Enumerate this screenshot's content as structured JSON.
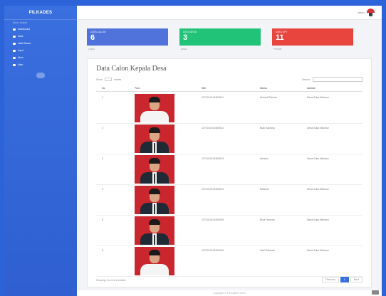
{
  "brand": "PILKADES",
  "sidebar": {
    "section_label": "Menu Utama",
    "items": [
      {
        "label": "Dashboard"
      },
      {
        "label": "Data"
      },
      {
        "label": "Hasil Suara"
      },
      {
        "label": "Input"
      },
      {
        "label": "Akun"
      },
      {
        "label": "User"
      }
    ]
  },
  "topbar": {
    "user_name": "admin"
  },
  "cards": [
    {
      "title": "DATA CALON",
      "value": "6",
      "sub": "Calon",
      "color": "#4f73db"
    },
    {
      "title": "DATA DESA",
      "value": "3",
      "sub": "Desa",
      "color": "#20c378"
    },
    {
      "title": "DATA DPT",
      "value": "11",
      "sub": "Pemilih",
      "color": "#e8453f"
    }
  ],
  "panel": {
    "title": "Data Calon Kepala Desa",
    "show_label": "Show",
    "show_value": "10",
    "entries_label": "entries",
    "search_label": "Search:",
    "columns": [
      "No",
      "Foto",
      "NIK",
      "Nama",
      "Alamat"
    ],
    "rows": [
      {
        "no": "1",
        "nik": "1371010101900001",
        "nama": "Ahmad Ridwan",
        "alamat": "Desa Suka Makmur",
        "suit": "white"
      },
      {
        "no": "2",
        "nik": "1371010101900002",
        "nama": "Budi Santoso",
        "alamat": "Desa Suka Makmur",
        "suit": "dark"
      },
      {
        "no": "3",
        "nik": "1371010101900003",
        "nama": "Hendra",
        "alamat": "Desa Suka Makmur",
        "suit": "dark"
      },
      {
        "no": "4",
        "nik": "1371010101900004",
        "nama": "Rahmat",
        "alamat": "Desa Suka Makmur",
        "suit": "dark"
      },
      {
        "no": "5",
        "nik": "1371010101900005",
        "nama": "Rudi Hartono",
        "alamat": "Desa Suka Makmur",
        "suit": "dark"
      },
      {
        "no": "6",
        "nik": "1371010101900006",
        "nama": "Zaki Rahman",
        "alamat": "Desa Suka Makmur",
        "suit": "white"
      }
    ],
    "footer_text": "Showing 1 to 6 of 6 entries",
    "pager": {
      "prev": "Previous",
      "current": "1",
      "next": "Next"
    }
  },
  "footer": "Copyright © PILKADES 2019"
}
